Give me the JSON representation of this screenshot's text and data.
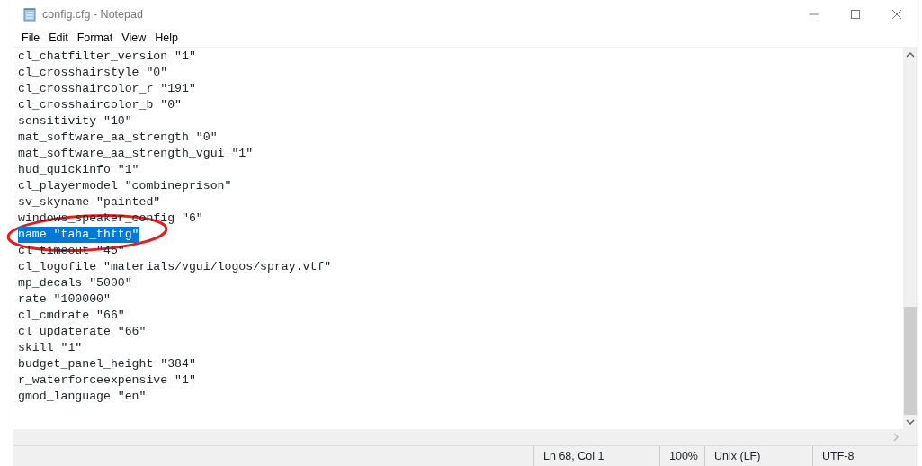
{
  "window": {
    "title": "config.cfg - Notepad"
  },
  "menu": [
    "File",
    "Edit",
    "Format",
    "View",
    "Help"
  ],
  "lines": [
    {
      "text": "cl_chatfilter_version \"1\"",
      "selected": false
    },
    {
      "text": "cl_crosshairstyle \"0\"",
      "selected": false
    },
    {
      "text": "cl_crosshaircolor_r \"191\"",
      "selected": false
    },
    {
      "text": "cl_crosshaircolor_b \"0\"",
      "selected": false
    },
    {
      "text": "sensitivity \"10\"",
      "selected": false
    },
    {
      "text": "mat_software_aa_strength \"0\"",
      "selected": false
    },
    {
      "text": "mat_software_aa_strength_vgui \"1\"",
      "selected": false
    },
    {
      "text": "hud_quickinfo \"1\"",
      "selected": false
    },
    {
      "text": "cl_playermodel \"combineprison\"",
      "selected": false
    },
    {
      "text": "sv_skyname \"painted\"",
      "selected": false
    },
    {
      "text": "windows_speaker_config \"6\"",
      "selected": false
    },
    {
      "text": "name \"taha_thttg\"",
      "selected": true
    },
    {
      "text": "cl_timeout \"45\"",
      "selected": false
    },
    {
      "text": "cl_logofile \"materials/vgui/logos/spray.vtf\"",
      "selected": false
    },
    {
      "text": "mp_decals \"5000\"",
      "selected": false
    },
    {
      "text": "rate \"100000\"",
      "selected": false
    },
    {
      "text": "cl_cmdrate \"66\"",
      "selected": false
    },
    {
      "text": "cl_updaterate \"66\"",
      "selected": false
    },
    {
      "text": "skill \"1\"",
      "selected": false
    },
    {
      "text": "budget_panel_height \"384\"",
      "selected": false
    },
    {
      "text": "r_waterforceexpensive \"1\"",
      "selected": false
    },
    {
      "text": "gmod_language \"en\"",
      "selected": false
    }
  ],
  "status_bar": [
    "Ln 68, Col 1",
    "100%",
    "Unix (LF)",
    "UTF-8"
  ]
}
